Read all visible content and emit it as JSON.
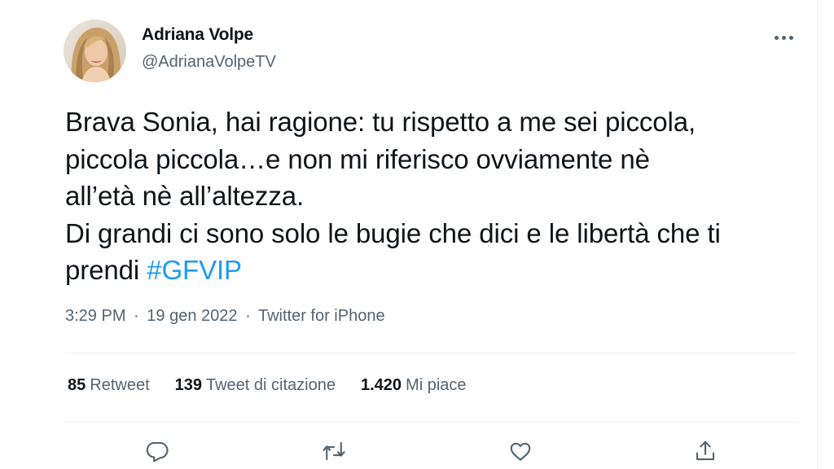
{
  "author": {
    "name": "Adriana Volpe",
    "handle": "@AdrianaVolpeTV"
  },
  "tweet": {
    "lines": [
      "Brava Sonia, hai ragione: tu rispetto a me sei piccola,",
      "piccola piccola…e non mi riferisco ovviamente nè",
      "all’età nè all’altezza.",
      "Di grandi ci sono solo le bugie che dici e le libertà che ti"
    ],
    "last_line_text": "prendi ",
    "hashtag": "#GFVIP"
  },
  "meta": {
    "time": "3:29 PM",
    "separator": "·",
    "date": "19 gen 2022",
    "source": "Twitter for iPhone"
  },
  "stats": {
    "retweets": {
      "count": "85",
      "label": "Retweet"
    },
    "quotes": {
      "count": "139",
      "label": "Tweet di citazione"
    },
    "likes": {
      "count": "1.420",
      "label": "Mi piace"
    }
  },
  "icons": {
    "more": "more-horizontal-icon",
    "reply": "reply-icon",
    "retweet": "retweet-icon",
    "like": "heart-icon",
    "share": "share-icon"
  },
  "colors": {
    "text": "#0f1419",
    "secondary": "#536471",
    "link": "#1d9bf0",
    "divider": "#eff3f4"
  }
}
